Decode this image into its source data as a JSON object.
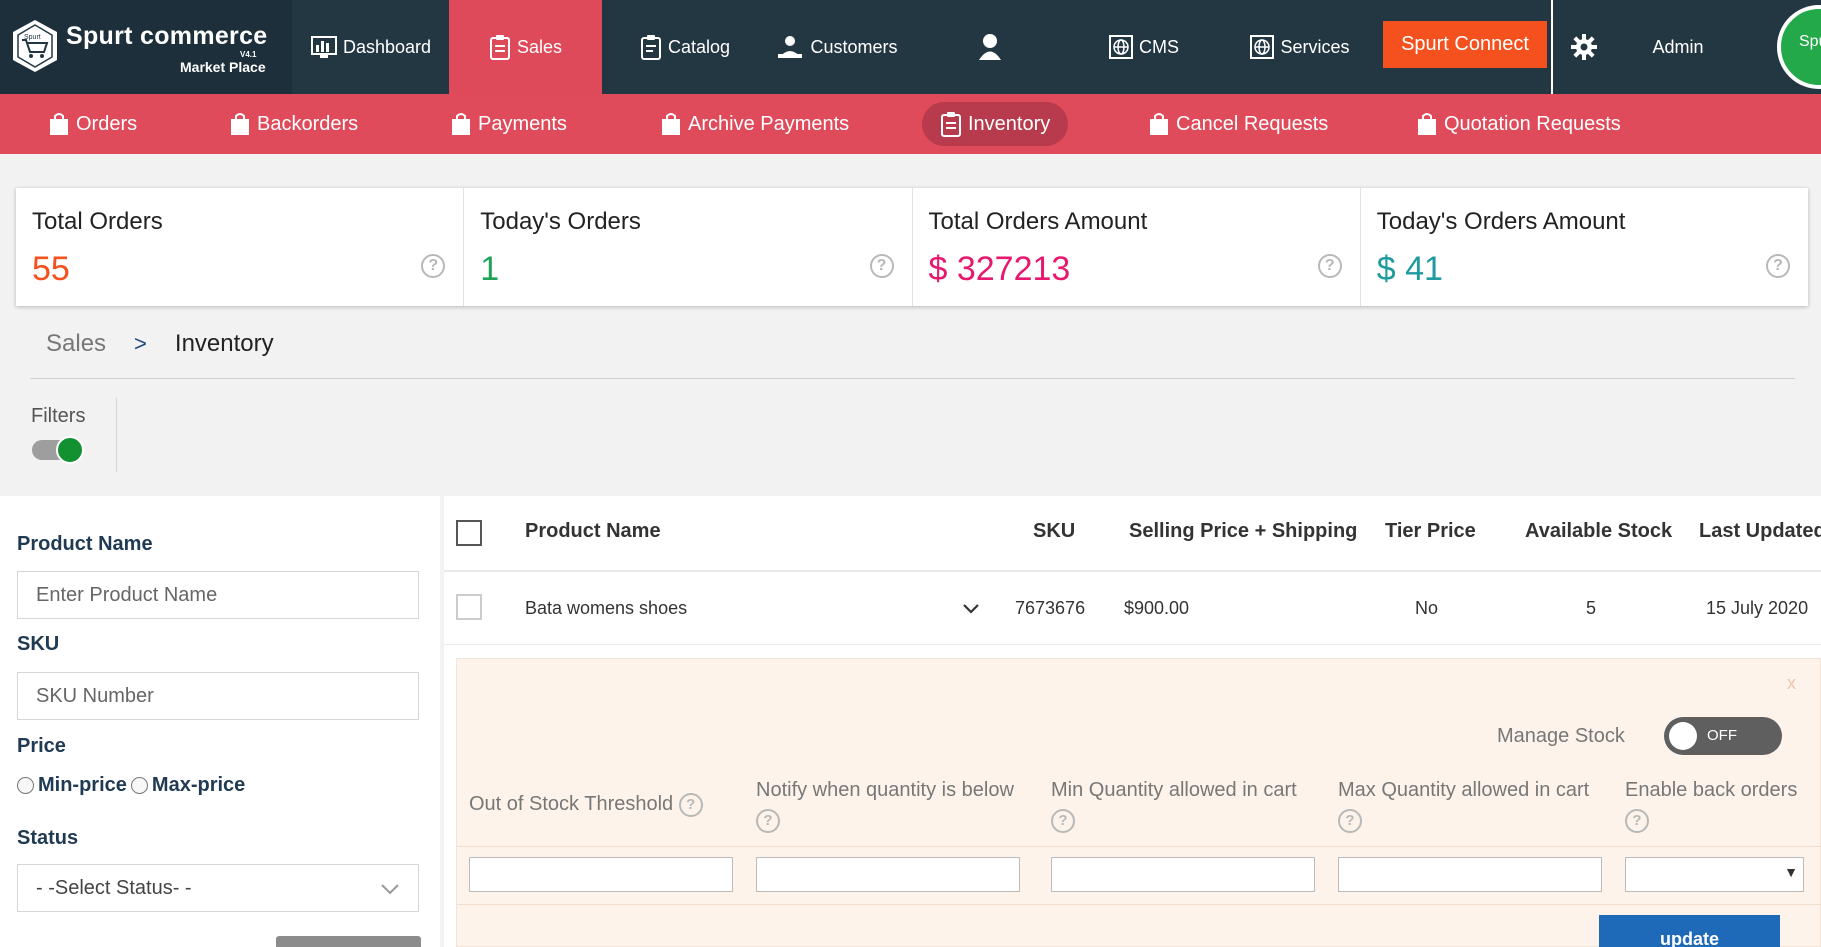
{
  "brand": {
    "title": "Spurt commerce",
    "version": "V4.1",
    "subtitle": "Market Place",
    "badge_text": "Spurt"
  },
  "topnav": {
    "dashboard": "Dashboard",
    "sales": "Sales",
    "catalog": "Catalog",
    "customers": "Customers",
    "cms": "CMS",
    "services": "Services",
    "connect": "Spurt Connect",
    "admin": "Admin",
    "avatar_text": "Spu"
  },
  "subnav": {
    "orders": "Orders",
    "backorders": "Backorders",
    "payments": "Payments",
    "archive_payments": "Archive Payments",
    "inventory": "Inventory",
    "cancel_requests": "Cancel Requests",
    "quotation_requests": "Quotation Requests"
  },
  "stats": [
    {
      "label": "Total Orders",
      "value": "55",
      "color": "#f5511e"
    },
    {
      "label": "Today's Orders",
      "value": "1",
      "color": "#1fa35a"
    },
    {
      "label": "Total Orders Amount",
      "value": "$ 327213",
      "color": "#e6196e"
    },
    {
      "label": "Today's Orders Amount",
      "value": "$ 41",
      "color": "#1e9aa0"
    }
  ],
  "help_glyph": "?",
  "breadcrumb": {
    "parent": "Sales",
    "separator": ">",
    "current": "Inventory"
  },
  "filters": {
    "label": "Filters",
    "product_name_label": "Product Name",
    "product_name_placeholder": "Enter Product Name",
    "sku_label": "SKU",
    "sku_placeholder": "SKU Number",
    "price_label": "Price",
    "min_price": "Min-price",
    "max_price": "Max-price",
    "status_label": "Status",
    "status_value": "- -Select Status- -"
  },
  "table": {
    "headers": {
      "product_name": "Product Name",
      "sku": "SKU",
      "selling_price": "Selling Price + Shipping",
      "tier_price": "Tier Price",
      "available_stock": "Available Stock",
      "last_updated": "Last Updated"
    },
    "rows": [
      {
        "product_name": "Bata womens shoes",
        "sku": "7673676",
        "selling_price": "$900.00",
        "tier_price": "No",
        "available_stock": "5",
        "last_updated": "15 July 2020"
      }
    ]
  },
  "editor": {
    "close": "x",
    "manage_stock_label": "Manage Stock",
    "manage_stock_state": "OFF",
    "out_of_stock_threshold": "Out of Stock Threshold",
    "notify_below": "Notify when quantity is below",
    "min_qty": "Min Quantity allowed in cart",
    "max_qty": "Max Quantity allowed in cart",
    "enable_back_orders": "Enable back orders",
    "select_arrow": "▼",
    "update_button": "update"
  }
}
